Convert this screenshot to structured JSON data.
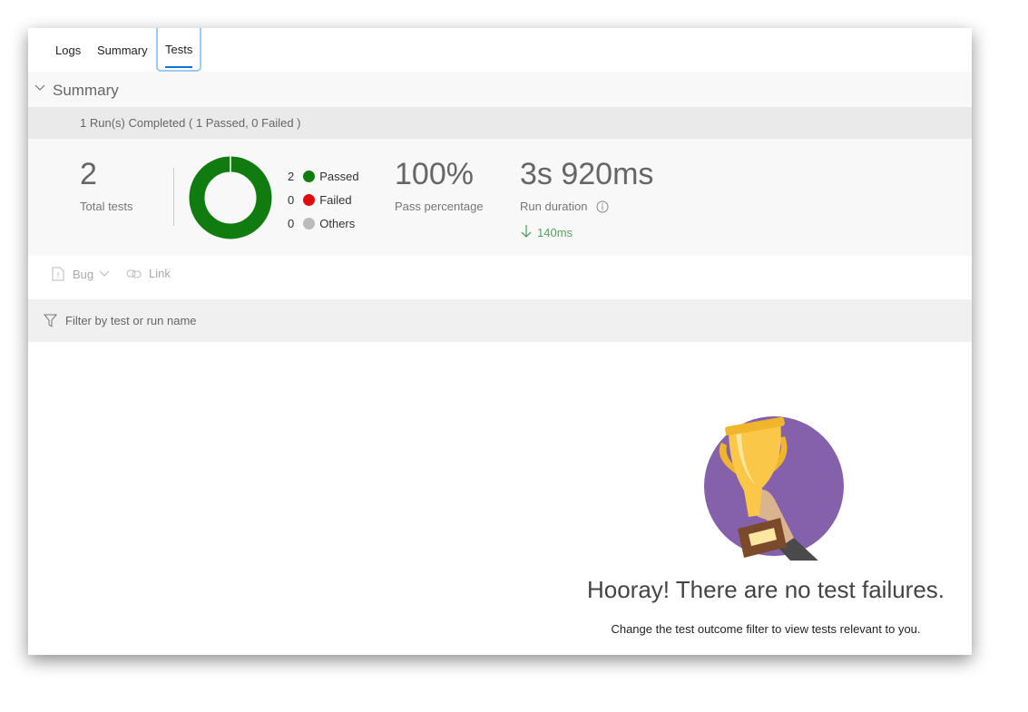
{
  "tabs": [
    {
      "label": "Logs"
    },
    {
      "label": "Summary"
    },
    {
      "label": "Tests",
      "active": true
    }
  ],
  "summary_header": "Summary",
  "run_status": "1 Run(s) Completed ( 1 Passed, 0 Failed )",
  "stats": {
    "total": {
      "value": "2",
      "label": "Total tests"
    },
    "outcomes": [
      {
        "count": "2",
        "label": "Passed",
        "color": "#107c10"
      },
      {
        "count": "0",
        "label": "Failed",
        "color": "#e00b0b"
      },
      {
        "count": "0",
        "label": "Others",
        "color": "#bbbbbb"
      }
    ],
    "pass": {
      "value": "100%",
      "label": "Pass percentage"
    },
    "duration": {
      "value": "3s 920ms",
      "label": "Run duration",
      "delta": "140ms",
      "delta_color": "#55a362"
    }
  },
  "toolbar": {
    "bug": "Bug",
    "link": "Link"
  },
  "filter": {
    "placeholder": "Filter by test or run name"
  },
  "empty": {
    "title": "Hooray! There are no test failures.",
    "subtitle": "Change the test outcome filter to view tests relevant to you."
  }
}
